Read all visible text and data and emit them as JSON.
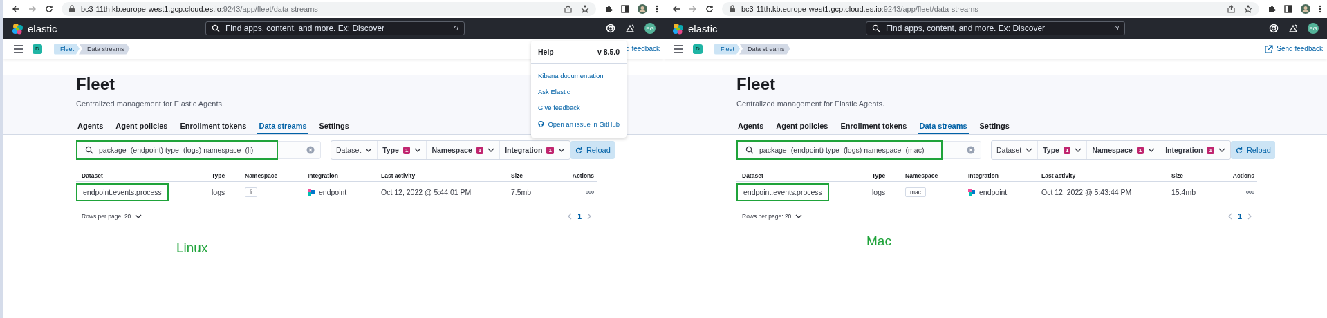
{
  "panels": [
    {
      "browser": {
        "url_host": "bc3-11th.kb.europe-west1.gcp.cloud.es.io",
        "url_path": ":9243/app/fleet/data-streams"
      },
      "header": {
        "logo_text": "elastic",
        "search_placeholder": "Find apps, content, and more. Ex: Discover",
        "shortcut": "^/",
        "avatar": "PG"
      },
      "nav": {
        "space": "D",
        "breadcrumbs": [
          "Fleet",
          "Data streams"
        ],
        "feedback": {
          "label": "d feedback",
          "icon": false
        }
      },
      "help_menu": {
        "title": "Help",
        "version": "v 8.5.0",
        "links": [
          {
            "label": "Kibana documentation",
            "icon": false
          },
          {
            "label": "Ask Elastic",
            "icon": false
          },
          {
            "label": "Give feedback",
            "icon": false
          },
          {
            "label": "Open an issue in GitHub",
            "icon": true
          }
        ]
      },
      "page": {
        "title": "Fleet",
        "subtitle": "Centralized management for Elastic Agents.",
        "tabs": [
          {
            "label": "Agents",
            "selected": false
          },
          {
            "label": "Agent policies",
            "selected": false
          },
          {
            "label": "Enrollment tokens",
            "selected": false
          },
          {
            "label": "Data streams",
            "selected": true
          },
          {
            "label": "Settings",
            "selected": false
          }
        ],
        "search": {
          "value": "package=(endpoint) type=(logs) namespace=(li)",
          "highlighted": true
        },
        "filters": [
          {
            "label": "Dataset"
          },
          {
            "label": "Type",
            "count": "1"
          },
          {
            "label": "Namespace",
            "count": "1"
          },
          {
            "label": "Integration",
            "count": "1"
          }
        ],
        "reload": "Reload",
        "table": {
          "columns": [
            "Dataset",
            "Type",
            "Namespace",
            "Integration",
            "Last activity",
            "Size",
            "Actions"
          ],
          "rows": [
            {
              "dataset": "endpoint.events.process",
              "highlighted": true,
              "type": "logs",
              "namespace": "li",
              "integration": "endpoint",
              "last_activity": "Oct 12, 2022 @ 5:44:01 PM",
              "size": "7.5mb"
            }
          ]
        },
        "pagination": {
          "rows_per_page": "Rows per page: 20",
          "pages": [
            {
              "label": "1",
              "selected": true
            }
          ]
        }
      },
      "annotation": "Linux"
    },
    {
      "browser": {
        "url_host": "bc3-11th.kb.europe-west1.gcp.cloud.es.io",
        "url_path": ":9243/app/fleet/data-streams"
      },
      "header": {
        "logo_text": "elastic",
        "search_placeholder": "Find apps, content, and more. Ex: Discover",
        "shortcut": "^/",
        "avatar": "PG"
      },
      "nav": {
        "space": "D",
        "breadcrumbs": [
          "Fleet",
          "Data streams"
        ],
        "feedback": {
          "label": "Send feedback",
          "icon": true
        }
      },
      "page": {
        "title": "Fleet",
        "subtitle": "Centralized management for Elastic Agents.",
        "tabs": [
          {
            "label": "Agents",
            "selected": false
          },
          {
            "label": "Agent policies",
            "selected": false
          },
          {
            "label": "Enrollment tokens",
            "selected": false
          },
          {
            "label": "Data streams",
            "selected": true
          },
          {
            "label": "Settings",
            "selected": false
          }
        ],
        "search": {
          "value": "package=(endpoint) type=(logs) namespace=(mac)",
          "highlighted": true
        },
        "filters": [
          {
            "label": "Dataset"
          },
          {
            "label": "Type",
            "count": "1"
          },
          {
            "label": "Namespace",
            "count": "1"
          },
          {
            "label": "Integration",
            "count": "1"
          }
        ],
        "reload": "Reload",
        "table": {
          "columns": [
            "Dataset",
            "Type",
            "Namespace",
            "Integration",
            "Last activity",
            "Size",
            "Actions"
          ],
          "rows": [
            {
              "dataset": "endpoint.events.process",
              "highlighted": true,
              "type": "logs",
              "namespace": "mac",
              "integration": "endpoint",
              "last_activity": "Oct 12, 2022 @ 5:43:44 PM",
              "size": "15.4mb"
            }
          ]
        },
        "pagination": {
          "rows_per_page": "Rows per page: 20",
          "pages": [
            {
              "label": "1",
              "selected": true
            }
          ]
        }
      },
      "annotation": "Mac"
    }
  ]
}
